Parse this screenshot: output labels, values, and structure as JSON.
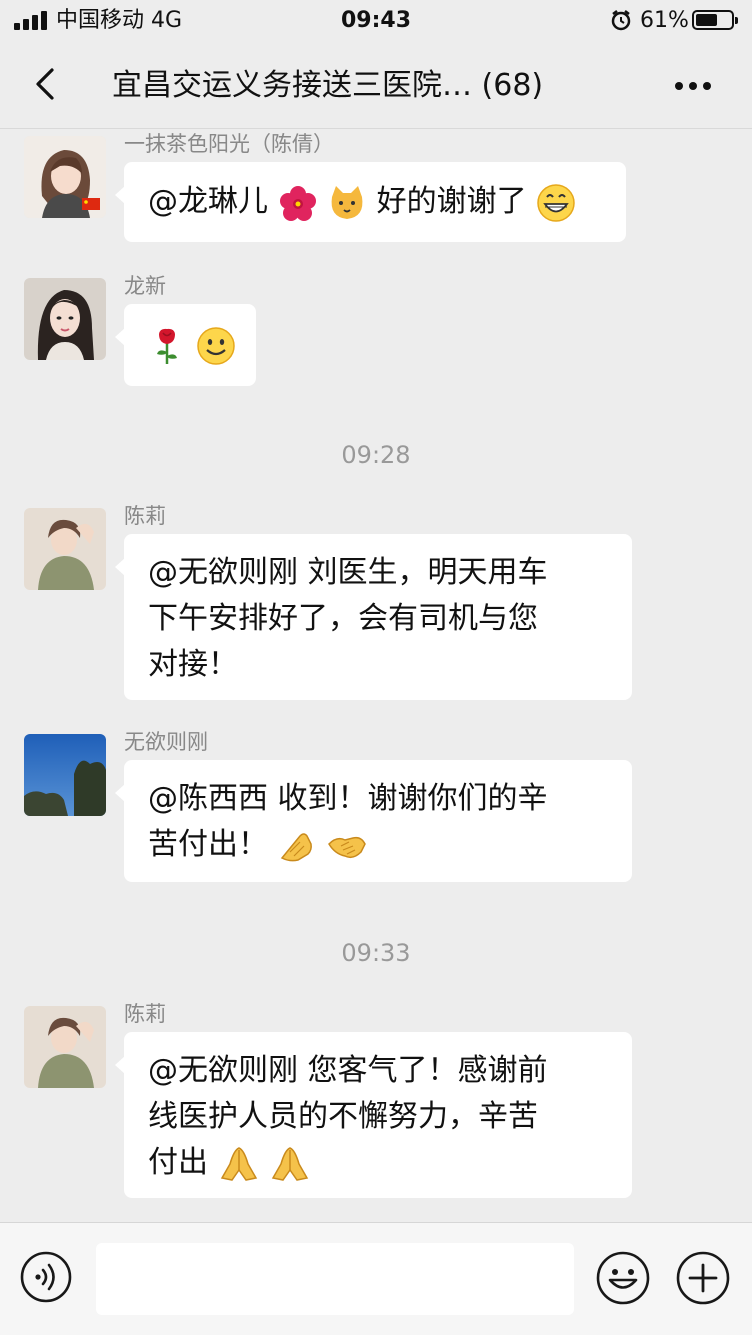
{
  "status_bar": {
    "carrier": "中国移动",
    "network": "4G",
    "time": "09:43",
    "battery": "61%",
    "battery_level": 0.61
  },
  "nav": {
    "title": "宜昌交运义务接送三医院…",
    "member_count": "(68)"
  },
  "messages": [
    {
      "sender": "一抹茶色阳光（陈倩）",
      "lines": [
        "@龙琳儿",
        "好的谢谢了"
      ],
      "emojis": [
        "hibiscus-emoji",
        "cat-face-emoji",
        "grinning-face-emoji"
      ]
    },
    {
      "sender": "龙新",
      "emojis": [
        "rose-emoji",
        "smiling-face-emoji"
      ]
    },
    {
      "timestamp": "09:28"
    },
    {
      "sender": "陈莉",
      "lines": [
        "@无欲则刚 刘医生，明天用车",
        "下午安排好了，会有司机与您",
        "对接！"
      ]
    },
    {
      "sender": "无欲则刚",
      "lines": [
        "@陈西西 收到！谢谢你们的辛",
        "苦付出！"
      ],
      "emojis": [
        "clapping-hand-emoji",
        "handshake-emoji"
      ]
    },
    {
      "timestamp": "09:33"
    },
    {
      "sender": "陈莉",
      "lines": [
        "@无欲则刚 您客气了！感谢前",
        "线医护人员的不懈努力，辛苦",
        "付出"
      ],
      "emojis": [
        "folded-hands-emoji",
        "folded-hands-emoji"
      ]
    }
  ],
  "input_bar": {
    "placeholder": "",
    "icons": [
      "voice-icon",
      "emoji-icon",
      "plus-icon"
    ]
  },
  "colors": {
    "background": "#ededed",
    "bubble": "#ffffff",
    "timestamp": "#999999",
    "sender_name": "#888888"
  }
}
